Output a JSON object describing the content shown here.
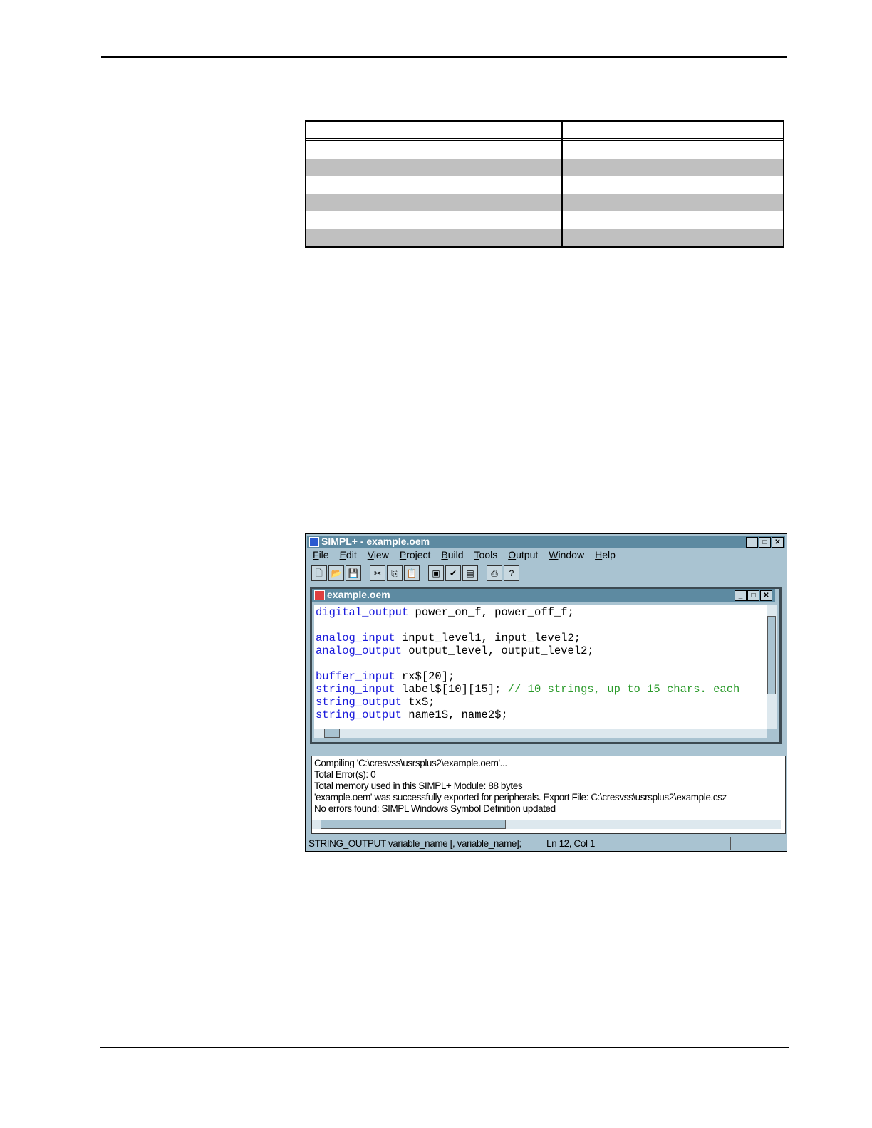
{
  "table": {
    "header": [
      "",
      ""
    ],
    "rows": [
      [
        "",
        ""
      ],
      [
        "",
        ""
      ],
      [
        "",
        ""
      ],
      [
        "",
        ""
      ],
      [
        "",
        ""
      ],
      [
        "",
        ""
      ]
    ]
  },
  "app": {
    "title": "SIMPL+ - example.oem",
    "menu": [
      "File",
      "Edit",
      "View",
      "Project",
      "Build",
      "Tools",
      "Output",
      "Window",
      "Help"
    ],
    "toolbar": [
      "new-icon",
      "open-icon",
      "save-icon",
      "cut-icon",
      "copy-icon",
      "paste-icon",
      "compile-icon",
      "export-icon",
      "save-compile-icon",
      "print-icon",
      "help-icon"
    ],
    "child_title": "example.oem",
    "code": [
      [
        {
          "k": "digital_output"
        },
        {
          "t": " power_on_f, power_off_f;"
        }
      ],
      [],
      [
        {
          "k": "analog_input"
        },
        {
          "t": " input_level1, input_level2;"
        }
      ],
      [
        {
          "k": "analog_output"
        },
        {
          "t": " output_level, output_level2;"
        }
      ],
      [],
      [
        {
          "k": "buffer_input"
        },
        {
          "t": " rx$[20];"
        }
      ],
      [
        {
          "k": "string_input"
        },
        {
          "t": " label$[10][15]; "
        },
        {
          "c": "// 10 strings, up to 15 chars. each"
        }
      ],
      [
        {
          "k": "string_output"
        },
        {
          "t": " tx$;"
        }
      ],
      [
        {
          "k": "string_output"
        },
        {
          "t": " name1$, name2$;"
        }
      ]
    ],
    "output": [
      "Compiling 'C:\\cresvss\\usrsplus2\\example.oem'...",
      "Total Error(s): 0",
      "Total memory used in this SIMPL+ Module: 88 bytes",
      "'example.oem' was successfully exported for peripherals.  Export File:  C:\\cresvss\\usrsplus2\\example.csz",
      "No errors found: SIMPL Windows Symbol Definition updated"
    ],
    "status": {
      "hint": "STRING_OUTPUT variable_name [, variable_name];",
      "position": "Ln 12, Col 1"
    }
  }
}
